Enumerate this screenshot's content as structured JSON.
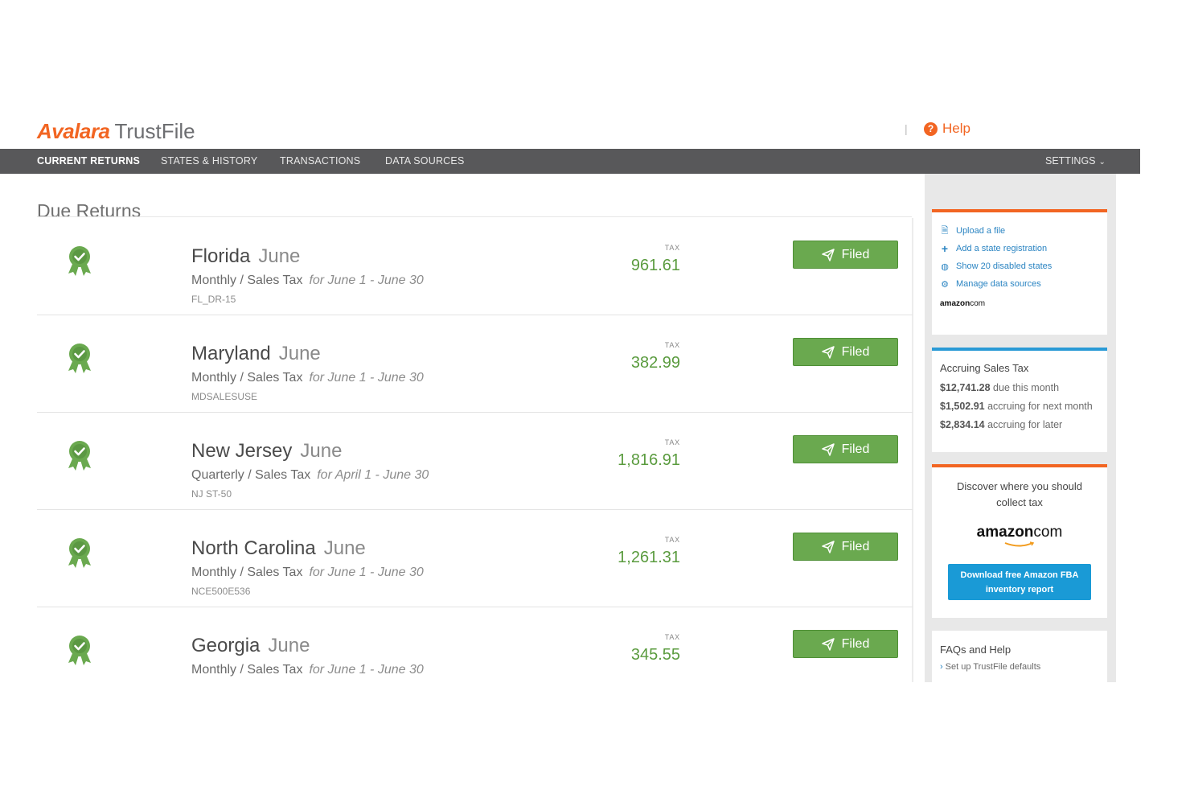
{
  "header": {
    "logo_brand": "Avalara",
    "logo_product": "TrustFile",
    "help_label": "Help"
  },
  "nav": {
    "items": [
      "CURRENT RETURNS",
      "STATES & HISTORY",
      "TRANSACTIONS",
      "DATA SOURCES"
    ],
    "active": "CURRENT RETURNS",
    "settings_label": "SETTINGS"
  },
  "main": {
    "title": "Due Returns",
    "returns": [
      {
        "state": "Florida",
        "month": "June",
        "type": "Monthly / Sales Tax",
        "period": "for June 1 - June 30",
        "form": "FL_DR-15",
        "tax_label": "TAX",
        "tax": "961.61",
        "status": "Filed"
      },
      {
        "state": "Maryland",
        "month": "June",
        "type": "Monthly / Sales Tax",
        "period": "for June 1 - June 30",
        "form": "MDSALESUSE",
        "tax_label": "TAX",
        "tax": "382.99",
        "status": "Filed"
      },
      {
        "state": "New Jersey",
        "month": "June",
        "type": "Quarterly / Sales Tax",
        "period": "for April 1 - June 30",
        "form": "NJ ST-50",
        "tax_label": "TAX",
        "tax": "1,816.91",
        "status": "Filed"
      },
      {
        "state": "North Carolina",
        "month": "June",
        "type": "Monthly / Sales Tax",
        "period": "for June 1 - June 30",
        "form": "NCE500E536",
        "tax_label": "TAX",
        "tax": "1,261.31",
        "status": "Filed"
      },
      {
        "state": "Georgia",
        "month": "June",
        "type": "Monthly / Sales Tax",
        "period": "for June 1 - June 30",
        "form": "",
        "tax_label": "TAX",
        "tax": "345.55",
        "status": "Filed"
      }
    ]
  },
  "sidebar": {
    "links": [
      {
        "label": "Upload a file",
        "icon": "file-icon"
      },
      {
        "label": "Add a state registration",
        "icon": "plus-icon"
      },
      {
        "label": "Show 20 disabled states",
        "icon": "eye-slash-icon"
      },
      {
        "label": "Manage data sources",
        "icon": "gear-icon"
      }
    ],
    "amazon_small": {
      "brand": "amazon",
      "suffix": "com"
    },
    "accruing": {
      "title": "Accruing Sales Tax",
      "lines": [
        {
          "amount": "$12,741.28",
          "text": "due this month"
        },
        {
          "amount": "$1,502.91",
          "text": "accruing for next month"
        },
        {
          "amount": "$2,834.14",
          "text": "accruing for later"
        }
      ]
    },
    "discover": {
      "text": "Discover where you should collect tax",
      "brand": "amazon",
      "suffix": "com",
      "button_line1": "Download free Amazon FBA",
      "button_line2": "inventory report"
    },
    "faq": {
      "title": "FAQs and Help",
      "link": "Set up TrustFile defaults"
    }
  },
  "colors": {
    "accent_orange": "#f26522",
    "nav_bg": "#58585a",
    "filed_green": "#6aa94f",
    "tax_green": "#5a9b3e",
    "link_blue": "#2a84c2",
    "button_blue": "#1a9ad6"
  }
}
